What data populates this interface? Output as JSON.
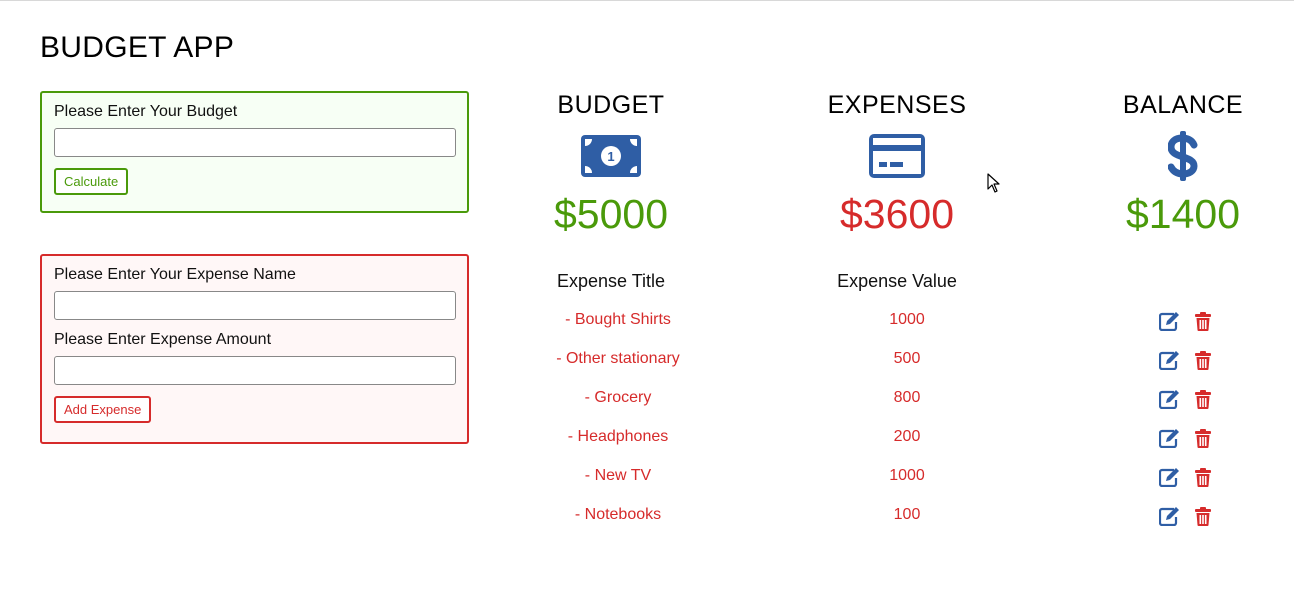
{
  "app": {
    "title": "BUDGET APP"
  },
  "budget_form": {
    "label": "Please Enter Your Budget",
    "input_value": "",
    "button_label": "Calculate"
  },
  "expense_form": {
    "name_label": "Please Enter Your Expense Name",
    "name_value": "",
    "amount_label": "Please Enter Expense Amount",
    "amount_value": "",
    "button_label": "Add Expense"
  },
  "summary": {
    "budget": {
      "title": "BUDGET",
      "amount": "$5000",
      "icon": "money-bill-icon",
      "color": "#4a9a0a"
    },
    "expenses": {
      "title": "EXPENSES",
      "amount": "$3600",
      "icon": "credit-card-icon",
      "color": "#d62b2b"
    },
    "balance": {
      "title": "BALANCE",
      "amount": "$1400",
      "icon": "dollar-sign-icon",
      "color": "#4a9a0a"
    }
  },
  "expense_list": {
    "columns": [
      "Expense Title",
      "Expense Value"
    ],
    "rows": [
      {
        "title": "- Bought Shirts",
        "value": "1000"
      },
      {
        "title": "- Other stationary",
        "value": "500"
      },
      {
        "title": "- Grocery",
        "value": "800"
      },
      {
        "title": "- Headphones",
        "value": "200"
      },
      {
        "title": "- New TV",
        "value": "1000"
      },
      {
        "title": "- Notebooks",
        "value": "100"
      }
    ],
    "edit_icon": "edit-icon",
    "delete_icon": "trash-icon"
  },
  "colors": {
    "accent_blue": "#2f5ea5",
    "green": "#4a9a0a",
    "red": "#d62b2b"
  }
}
